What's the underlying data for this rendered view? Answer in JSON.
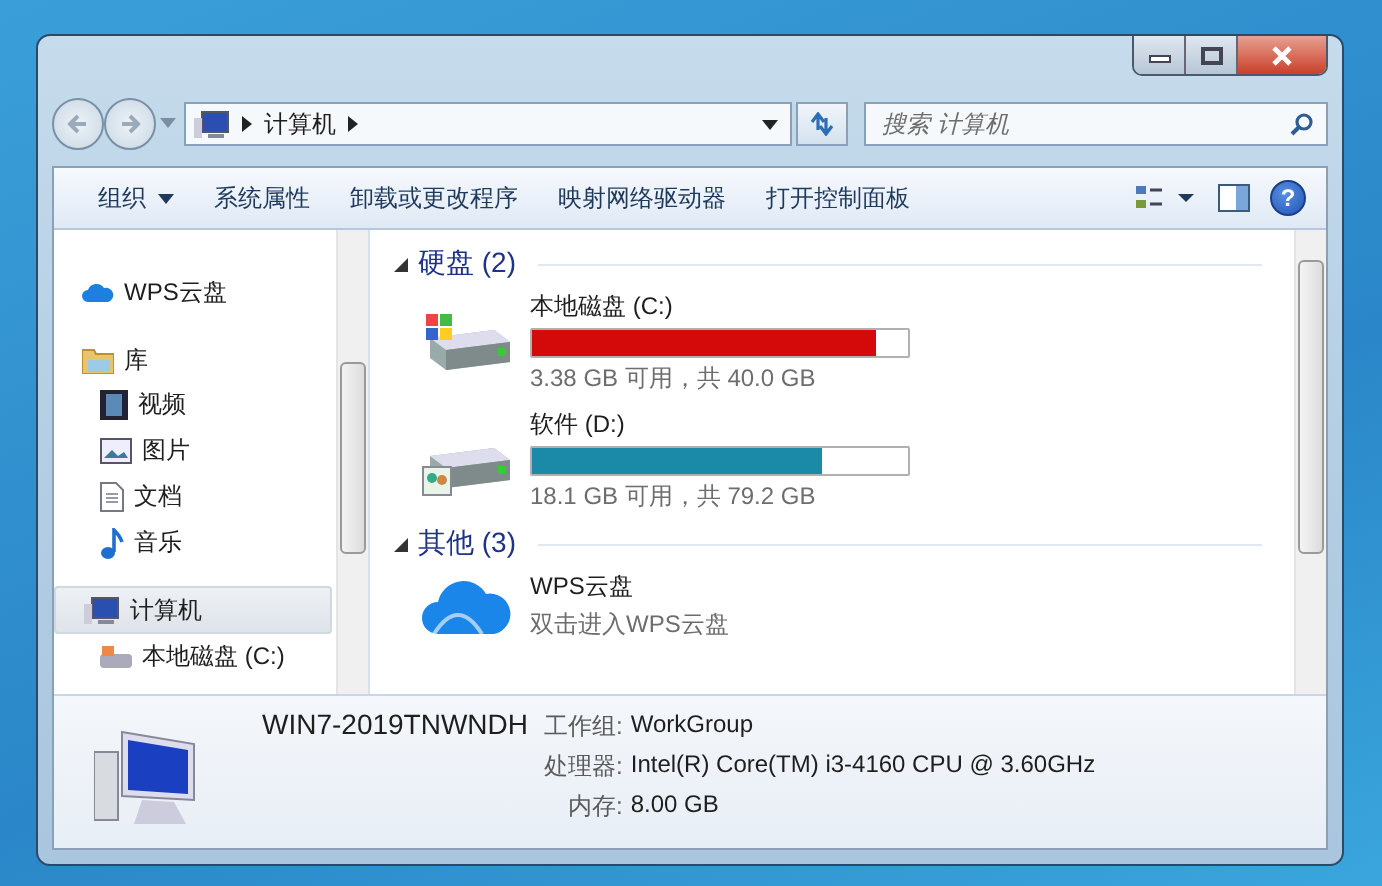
{
  "address": {
    "segments": [
      "计算机"
    ]
  },
  "search": {
    "placeholder": "搜索 计算机"
  },
  "toolbar": {
    "items": [
      {
        "label": "组织",
        "dropdown": true
      },
      {
        "label": "系统属性",
        "dropdown": false
      },
      {
        "label": "卸载或更改程序",
        "dropdown": false
      },
      {
        "label": "映射网络驱动器",
        "dropdown": false
      },
      {
        "label": "打开控制面板",
        "dropdown": false
      }
    ],
    "help": "?"
  },
  "sidebar": {
    "items": [
      {
        "label": "WPS云盘",
        "kind": "cloud",
        "selected": false
      },
      {
        "label": "库",
        "kind": "library",
        "selected": false,
        "children": [
          {
            "label": "视频",
            "kind": "video",
            "selected": false
          },
          {
            "label": "图片",
            "kind": "picture",
            "selected": false
          },
          {
            "label": "文档",
            "kind": "document",
            "selected": false
          },
          {
            "label": "音乐",
            "kind": "music",
            "selected": false
          }
        ]
      },
      {
        "label": "计算机",
        "kind": "computer",
        "selected": true,
        "children": [
          {
            "label": "本地磁盘 (C:)",
            "kind": "drive",
            "selected": false
          }
        ]
      }
    ]
  },
  "sections": [
    {
      "title": "硬盘 (2)",
      "expanded": true,
      "items": [
        {
          "kind": "system-drive",
          "name": "本地磁盘 (C:)",
          "level": 0.915,
          "color": "#d40a0a",
          "reading": "3.38 GB 可用，共 40.0 GB"
        },
        {
          "kind": "shared-drive",
          "name": "软件 (D:)",
          "level": 0.77,
          "color": "#1a8aa8",
          "reading": "18.1 GB 可用，共 79.2 GB"
        }
      ]
    },
    {
      "title": "其他 (3)",
      "expanded": true,
      "items": [
        {
          "kind": "cloud",
          "name": "WPS云盘",
          "description": "双击进入WPS云盘"
        }
      ]
    }
  ],
  "details": {
    "name": "WIN7-2019TNWNDH",
    "fields": [
      {
        "label": "工作组:",
        "value": "WorkGroup"
      },
      {
        "label": "处理器:",
        "value": "Intel(R) Core(TM) i3-4160 CPU @ 3.60GHz"
      },
      {
        "label": "内存:",
        "value": "8.00 GB"
      }
    ]
  }
}
